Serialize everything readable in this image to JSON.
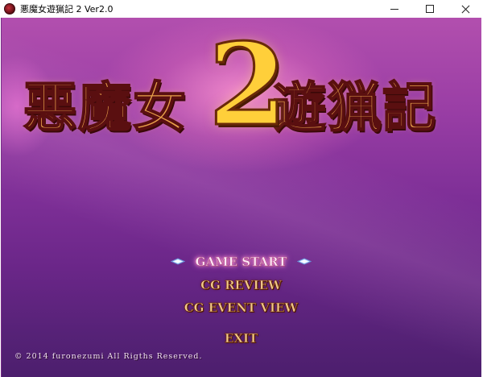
{
  "window": {
    "title": "悪魔女遊猟記 2  Ver2.0",
    "icon": "app-icon",
    "controls": {
      "minimize_icon": "minimize-icon",
      "maximize_icon": "maximize-icon",
      "close_icon": "close-icon"
    }
  },
  "logo": {
    "left_text": "悪魔女",
    "number": "2",
    "right_text": "遊猟記",
    "colors": {
      "gold": "#f4b24a",
      "outline": "#5a0f10",
      "number": "#ffcf3a"
    }
  },
  "menu": {
    "items": [
      {
        "label": "GAME START",
        "selected": true
      },
      {
        "label": "CG REVIEW",
        "selected": false
      },
      {
        "label": "CG EVENT  VIEW",
        "selected": false
      },
      {
        "label": "EXIT",
        "selected": false
      }
    ],
    "cursor_icon": "gem-cursor-icon"
  },
  "footer": {
    "copyright": "© 2014 furonezumi All Rigths Reserved."
  },
  "colors": {
    "background_top": "#b24fae",
    "background_bottom": "#4c1e6d",
    "menu_text": "#f0c98a",
    "menu_selected": "#ffe9f6"
  }
}
